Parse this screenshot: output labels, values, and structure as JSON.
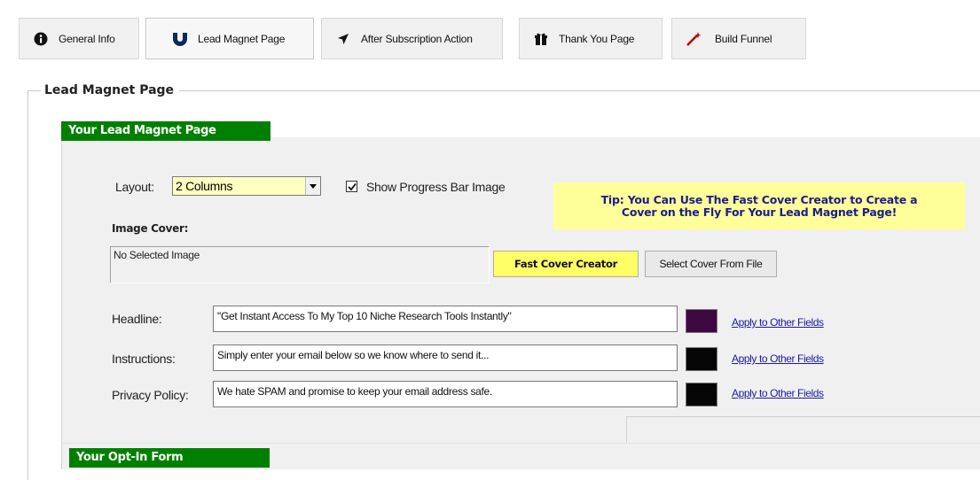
{
  "tabs": [
    {
      "label": "General Info",
      "icon": "info-icon"
    },
    {
      "label": "Lead Magnet Page",
      "icon": "magnet-icon"
    },
    {
      "label": "After Subscription Action",
      "icon": "arrow-icon"
    },
    {
      "label": "Thank You Page",
      "icon": "gift-icon"
    },
    {
      "label": "Build Funnel",
      "icon": "wand-icon"
    }
  ],
  "group_title": "Lead Magnet Page",
  "section1_title": "Your Lead Magnet Page",
  "section2_title": "Your Opt-In Form",
  "layout": {
    "label": "Layout:",
    "value": "2 Columns"
  },
  "progress_checkbox": {
    "label": "Show Progress Bar Image",
    "checked": true
  },
  "tip": {
    "line1": "Tip: You Can Use The Fast Cover Creator to Create a",
    "line2": "Cover on the Fly For Your Lead Magnet Page!"
  },
  "image_cover": {
    "label": "Image Cover:",
    "value": "No Selected Image"
  },
  "buttons": {
    "fast_cover": "Fast Cover Creator",
    "select_cover": "Select Cover From File"
  },
  "fields": [
    {
      "label": "Headline:",
      "value": "\"Get Instant Access To My Top 10 Niche Research Tools Instantly\"",
      "color": "#3d0840",
      "link": "Apply to Other Fields"
    },
    {
      "label": "Instructions:",
      "value": "Simply enter your email below so we know where to send it...",
      "color": "#050505",
      "link": "Apply to Other Fields"
    },
    {
      "label": "Privacy Policy:",
      "value": "We hate SPAM and promise to keep your email address safe.",
      "color": "#050505",
      "link": "Apply to Other Fields"
    }
  ],
  "colors": {
    "accent_green": "#008000",
    "tip_bg": "#ffff99",
    "fast_btn": "#ffff66"
  }
}
